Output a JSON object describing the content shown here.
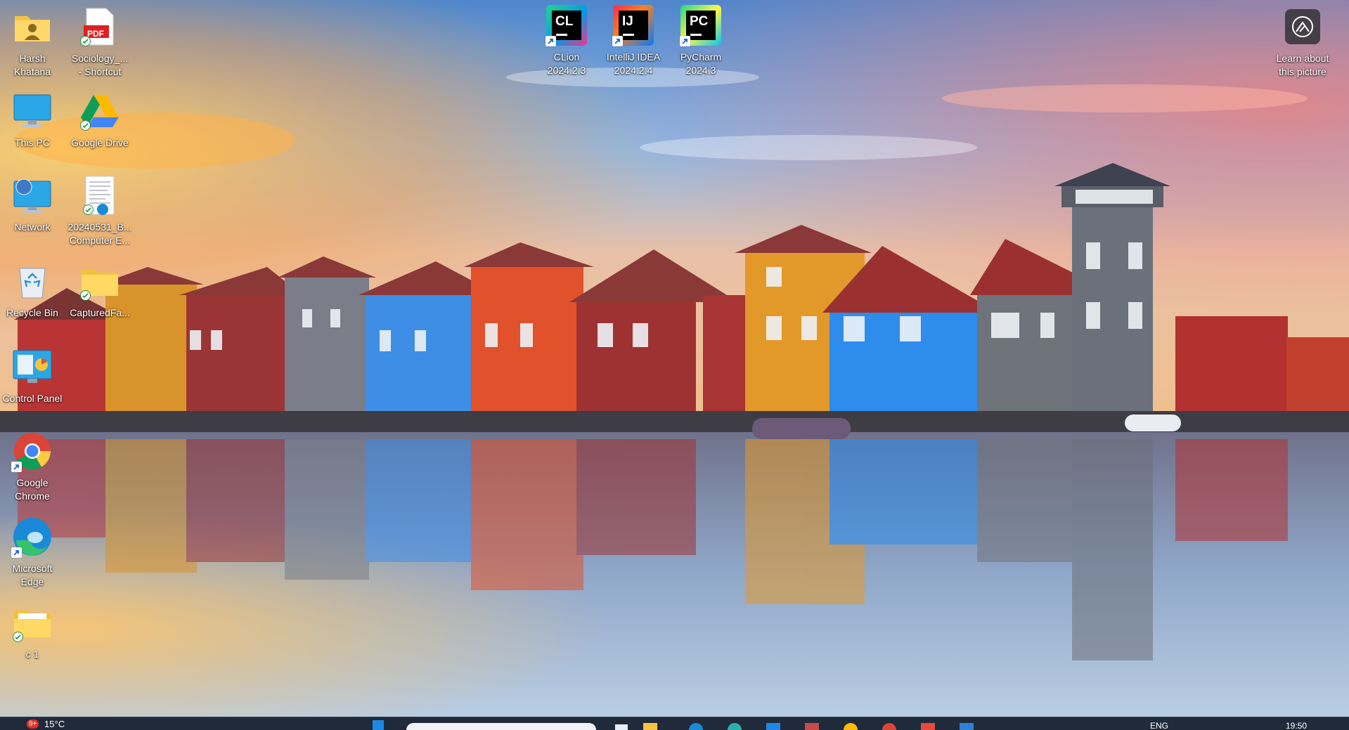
{
  "desktop": {
    "icons": [
      {
        "key": "harsh",
        "label": "Harsh\nKhatana",
        "icon": "user-folder-icon"
      },
      {
        "key": "sociology",
        "label": "Sociology_...\n- Shortcut",
        "icon": "pdf-file-icon",
        "badge": "PDF"
      },
      {
        "key": "thispc",
        "label": "This PC",
        "icon": "monitor-icon"
      },
      {
        "key": "gdrive",
        "label": "Google Drive",
        "icon": "google-drive-icon"
      },
      {
        "key": "network",
        "label": "Network",
        "icon": "network-icon"
      },
      {
        "key": "doc2024",
        "label": "20240531_B...\nComputer E...",
        "icon": "document-icon"
      },
      {
        "key": "recycle",
        "label": "Recycle Bin",
        "icon": "recycle-bin-icon"
      },
      {
        "key": "captured",
        "label": "CapturedFa...",
        "icon": "folder-icon"
      },
      {
        "key": "controlpanel",
        "label": "Control Panel",
        "icon": "control-panel-icon"
      },
      {
        "key": "chrome",
        "label": "Google\nChrome",
        "icon": "chrome-icon"
      },
      {
        "key": "edge",
        "label": "Microsoft\nEdge",
        "icon": "edge-icon"
      },
      {
        "key": "c1",
        "label": "c 1",
        "icon": "folder-icon"
      },
      {
        "key": "clion",
        "label": "CLion\n2024.2.3",
        "icon": "clion-icon",
        "badge": "CL"
      },
      {
        "key": "intellij",
        "label": "IntelliJ IDEA\n2024.2.4",
        "icon": "intellij-icon",
        "badge": "IJ"
      },
      {
        "key": "pycharm",
        "label": "PyCharm\n2024.3",
        "icon": "pycharm-icon",
        "badge": "PC"
      },
      {
        "key": "learn",
        "label": "Learn about\nthis picture",
        "icon": "camera-icon"
      }
    ]
  },
  "taskbar": {
    "weather": "15°C",
    "notification_count": "9+",
    "language": "ENG",
    "clock": "19:50"
  },
  "colors": {
    "sky_top": "#5a8fd0",
    "sunset": "#f7b66a",
    "taskbar": "#1f2a3a"
  }
}
